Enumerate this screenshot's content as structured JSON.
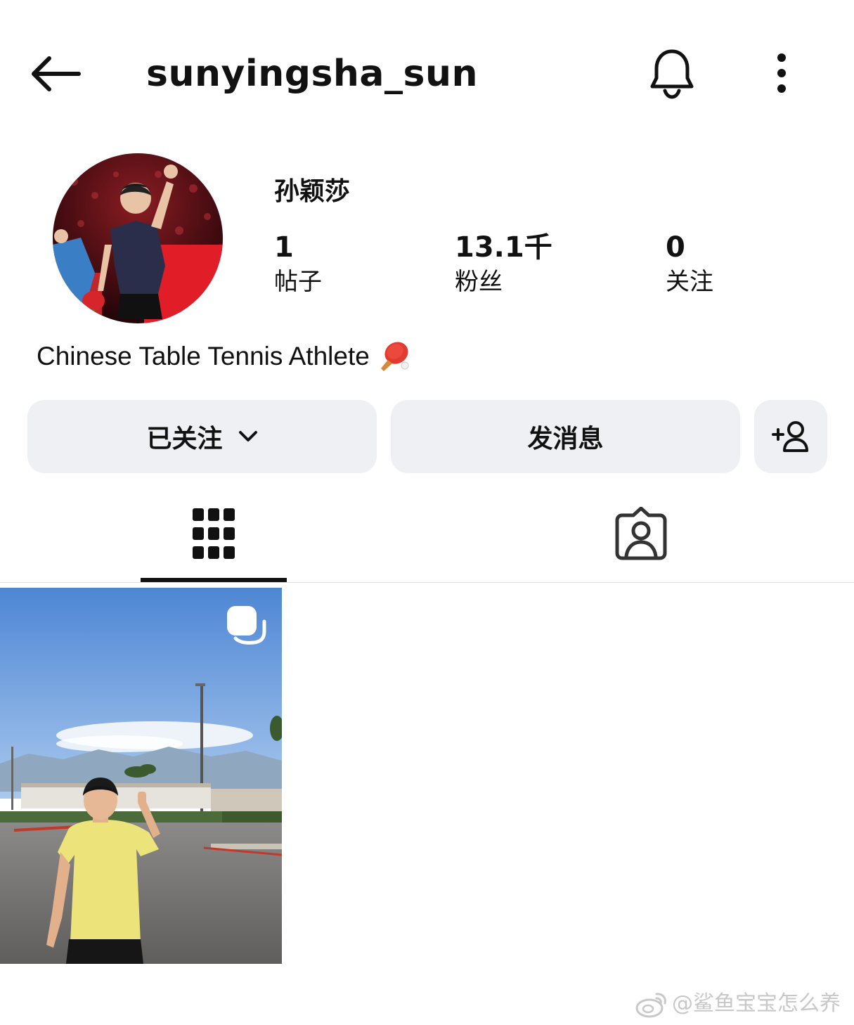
{
  "header": {
    "username": "sunyingsha_sun",
    "back_icon": "arrow-left-icon",
    "bell_icon": "bell-icon",
    "more_icon": "more-vertical-icon"
  },
  "profile": {
    "display_name": "孙颖莎",
    "avatar_icon": "profile-photo",
    "stats": {
      "posts": {
        "value": "1",
        "label": "帖子"
      },
      "followers": {
        "value": "13.1千",
        "label": "粉丝"
      },
      "following": {
        "value": "0",
        "label": "关注"
      }
    },
    "bio": "Chinese Table Tennis Athlete",
    "bio_emoji": "ping-pong-paddle-icon"
  },
  "actions": {
    "following_label": "已关注",
    "message_label": "发消息",
    "add_user_icon": "add-person-icon"
  },
  "tabs": [
    {
      "icon": "grid-icon",
      "active": true
    },
    {
      "icon": "tagged-person-icon",
      "active": false
    }
  ],
  "posts": [
    {
      "icon": "carousel-icon",
      "type": "carousel"
    }
  ],
  "watermark": {
    "text": "@鲨鱼宝宝怎么养",
    "icon": "weibo-icon"
  },
  "colors": {
    "button_bg": "#eff0f4",
    "text": "#111111",
    "divider": "#dbdbdb",
    "watermark": "#c8c8c8"
  }
}
